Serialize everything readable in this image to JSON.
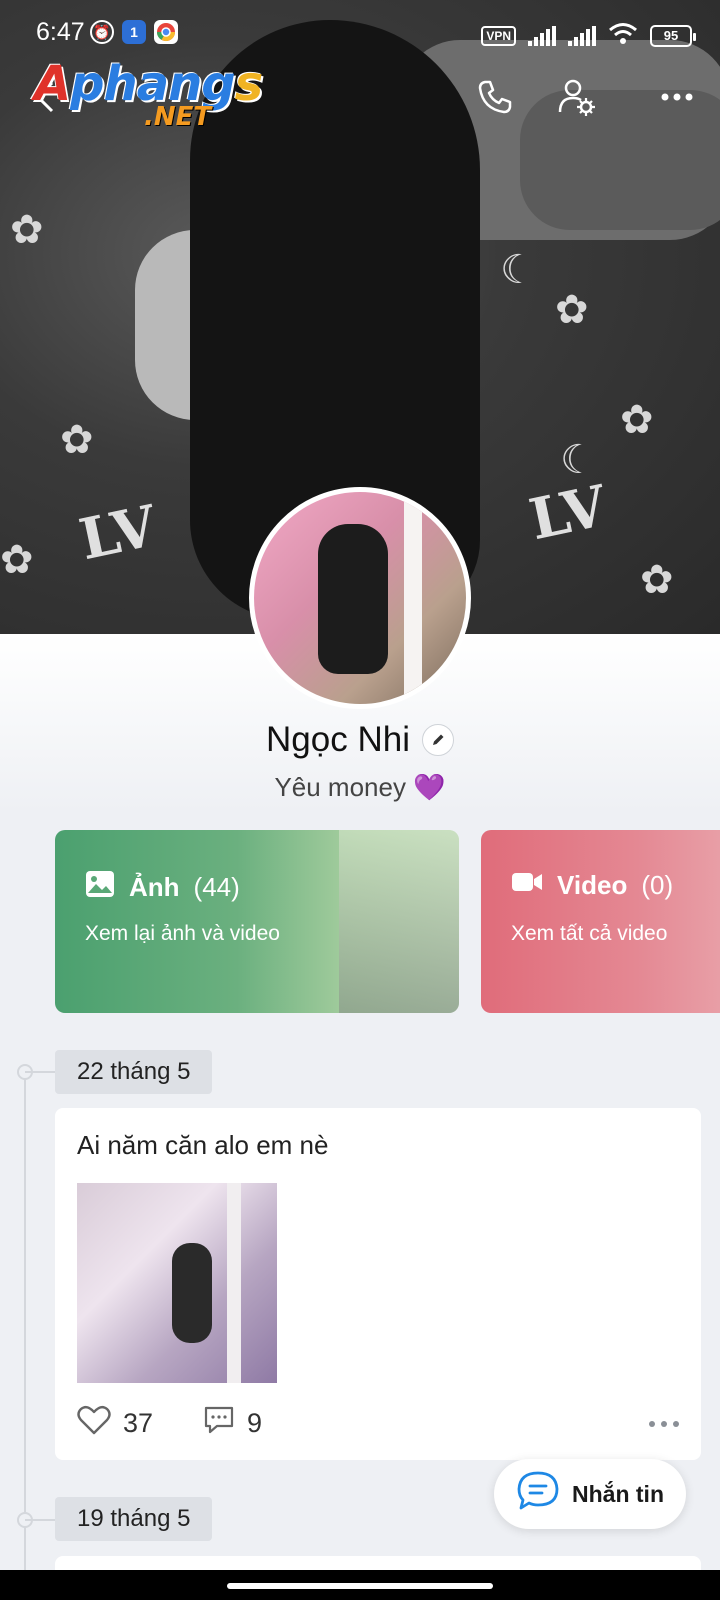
{
  "status_bar": {
    "time": "6:47",
    "vpn": "VPN",
    "battery": "95"
  },
  "watermark": {
    "line1": "Aphangs",
    "line2": ".NET"
  },
  "profile": {
    "name": "Ngọc Nhi",
    "bio": "Yêu money 💜"
  },
  "media_cards": {
    "photos": {
      "title": "Ảnh",
      "count": "(44)",
      "subtitle": "Xem lại ảnh và video"
    },
    "videos": {
      "title": "Video",
      "count": "(0)",
      "subtitle": "Xem tất cả video"
    }
  },
  "timeline": [
    {
      "date": "22 tháng 5",
      "post_text": "Ai năm căn alo em nè",
      "likes": "37",
      "comments": "9"
    },
    {
      "date": "19 tháng 5"
    }
  ],
  "message_button": {
    "label": "Nhắn tin"
  },
  "colors": {
    "photos_card": "#4ba06f",
    "videos_card": "#e06c7a",
    "accent_blue": "#1e88e5",
    "background": "#eef0f4"
  },
  "icons": [
    "back-icon",
    "phone-icon",
    "user-settings-icon",
    "more-icon",
    "edit-icon",
    "image-icon",
    "video-camera-icon",
    "heart-icon",
    "comment-icon",
    "chat-bubble-icon"
  ]
}
